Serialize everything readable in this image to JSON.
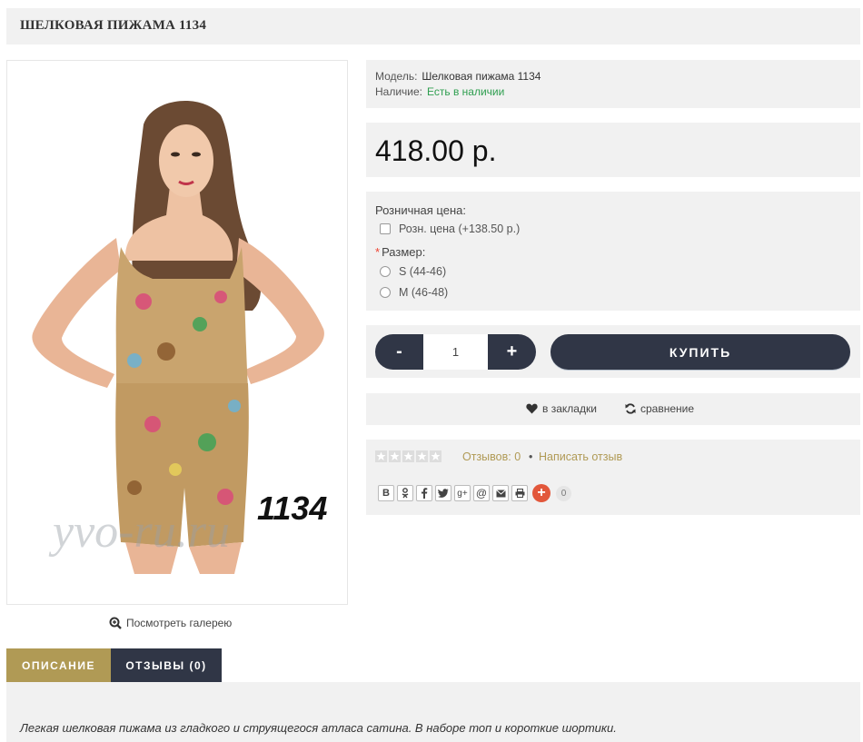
{
  "product": {
    "title": "ШЕЛКОВАЯ ПИЖАМА 1134",
    "image_number": "1134",
    "watermark": "yvo-ru.ru"
  },
  "gallery": {
    "label": "Посмотреть галерею"
  },
  "info": {
    "model_label": "Модель:",
    "model_value": "Шелковая пижама 1134",
    "stock_label": "Наличие:",
    "stock_value": "Есть в наличии"
  },
  "price": {
    "value": "418.00 р."
  },
  "options": {
    "retail_heading": "Розничная цена:",
    "retail_option": "Розн. цена (+138.50 р.)",
    "size_heading": "Размер:",
    "size_required_mark": "*",
    "sizes": [
      "S (44-46)",
      "M (46-48)"
    ]
  },
  "cart": {
    "minus": "-",
    "plus": "+",
    "quantity": "1",
    "buy_label": "КУПИТЬ"
  },
  "actions": {
    "wishlist": "в закладки",
    "compare": "сравнение"
  },
  "reviews": {
    "rating": 0,
    "reviews_count": "Отзывов: 0",
    "separator": "•",
    "write_review": "Написать отзыв"
  },
  "share": {
    "buttons": [
      "В",
      "ok",
      "f",
      "twitter",
      "g+",
      "@",
      "mail",
      "print"
    ],
    "labels": {
      "vk": "B",
      "gplus": "g+",
      "at": "@"
    },
    "add": "+",
    "count": "0"
  },
  "tabs": [
    {
      "label": "ОПИСАНИЕ"
    },
    {
      "label": "ОТЗЫВЫ (0)"
    }
  ],
  "description": "Легкая шелковая пижама из гладкого и струящегося атласа сатина. В наборе топ и короткие шортики.",
  "colors": {
    "dark": "#303646",
    "gold": "#b09a55",
    "stock_green": "#2e9e4f",
    "panel_bg": "#f1f1f1",
    "share_plus": "#e2573b"
  }
}
